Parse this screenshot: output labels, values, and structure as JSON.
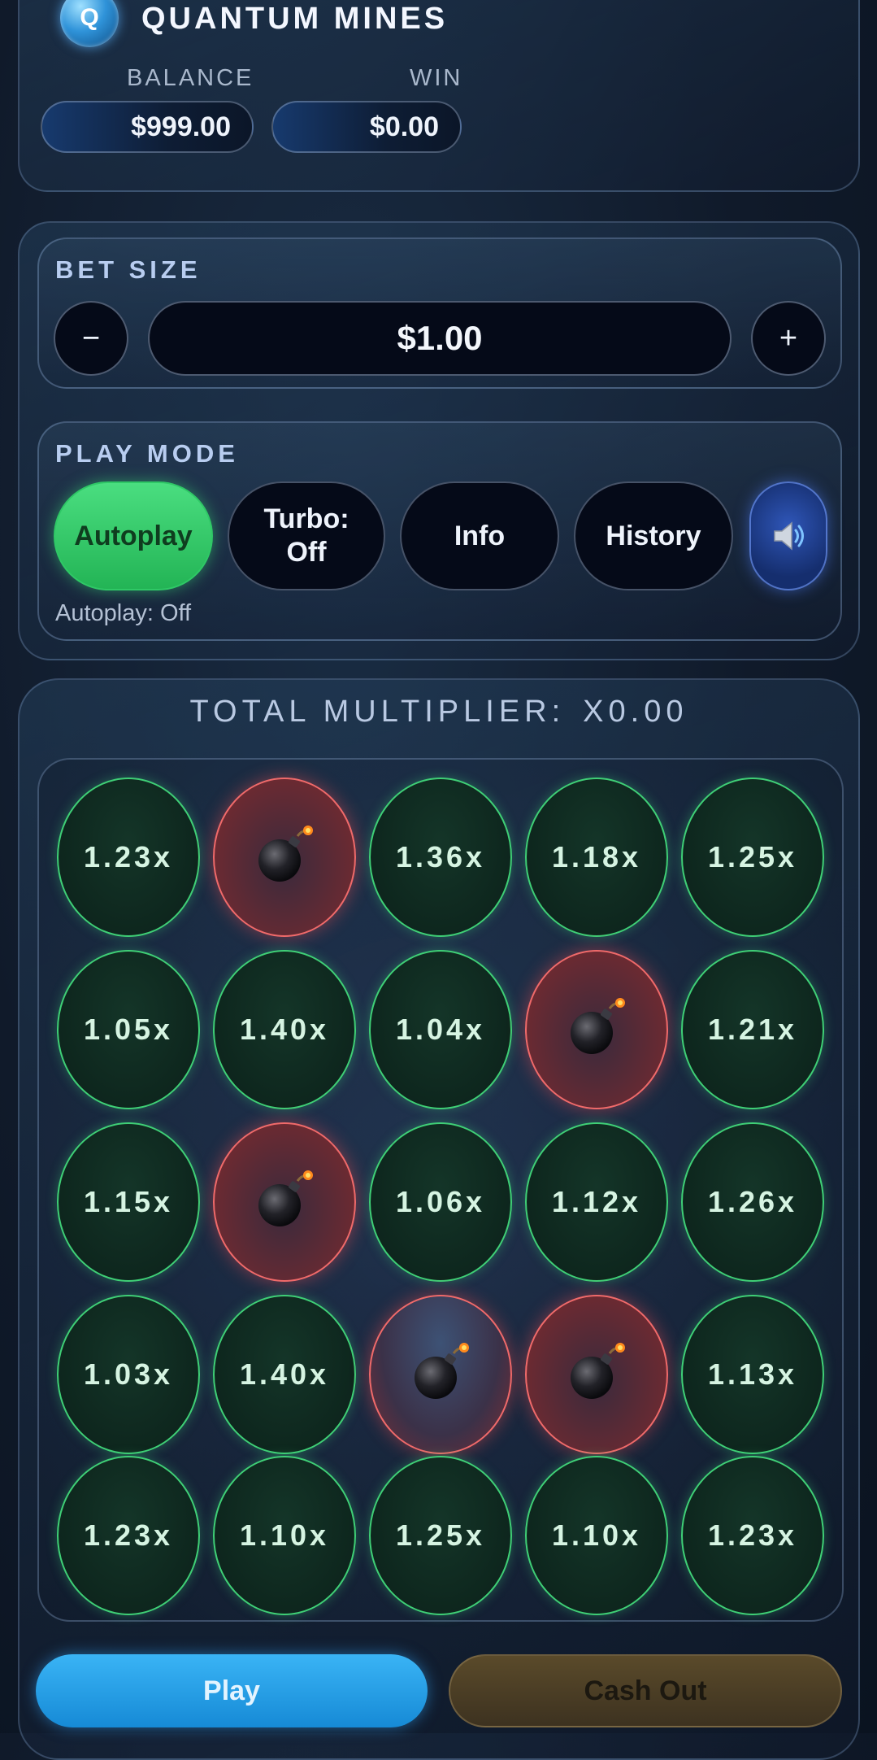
{
  "header": {
    "logo_letter": "Q",
    "title": "QUANTUM MINES",
    "balance_label": "BALANCE",
    "balance_value": "$999.00",
    "win_label": "WIN",
    "win_value": "$0.00"
  },
  "bet": {
    "label": "BET SIZE",
    "decrease": "−",
    "value": "$1.00",
    "increase": "+"
  },
  "play_mode": {
    "label": "PLAY MODE",
    "autoplay": "Autoplay",
    "turbo": "Turbo: Off",
    "info": "Info",
    "history": "History",
    "sound_icon": "speaker-icon",
    "status": "Autoplay: Off"
  },
  "board": {
    "total_label": "TOTAL MULTIPLIER:",
    "total_value": "X0.00",
    "tiles": [
      [
        "1.23x",
        "mine",
        "1.36x",
        "1.18x",
        "1.25x"
      ],
      [
        "1.05x",
        "1.40x",
        "1.04x",
        "mine",
        "1.21x"
      ],
      [
        "1.15x",
        "mine",
        "1.06x",
        "1.12x",
        "1.26x"
      ],
      [
        "1.03x",
        "1.40x",
        "mine",
        "mine",
        "1.13x"
      ],
      [
        "1.23x",
        "1.10x",
        "1.25x",
        "1.10x",
        "1.23x"
      ]
    ]
  },
  "actions": {
    "play": "Play",
    "cash_out": "Cash Out"
  },
  "colors": {
    "safe_border": "#3fcf76",
    "mine_border": "#f06a6a",
    "autoplay_active": "#2fc866",
    "play_button": "#1a9ae6"
  }
}
